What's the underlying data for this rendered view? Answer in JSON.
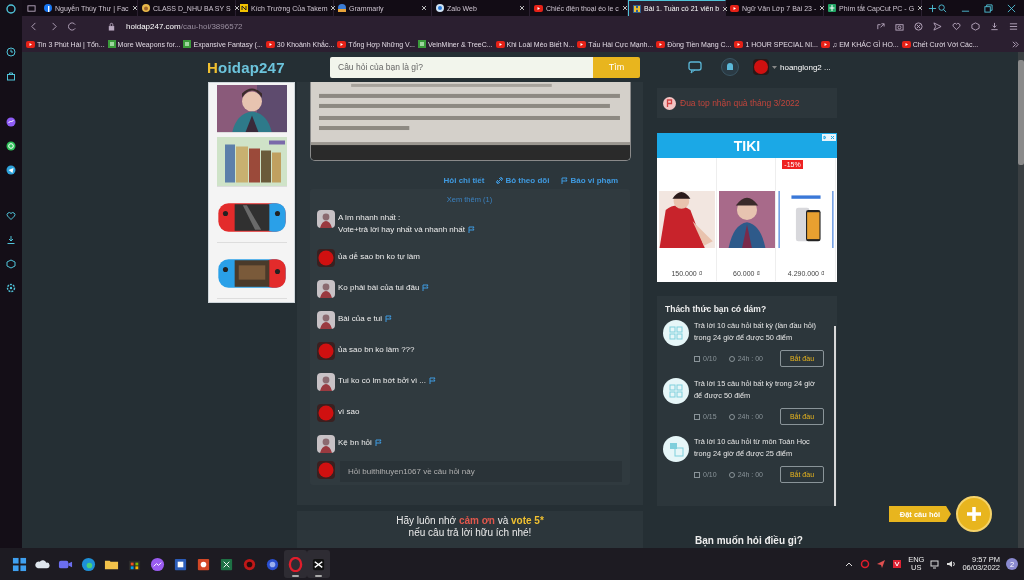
{
  "browser": {
    "tabs": [
      {
        "title": "Nguyễn Thùy Thư | Fac",
        "kind": "facebook",
        "selected": false
      },
      {
        "title": "CLASS D_NHU BA SY S",
        "kind": "class",
        "selected": false
      },
      {
        "title": "Kích Trường Của Takem",
        "kind": "n",
        "selected": false
      },
      {
        "title": "Grammarly",
        "kind": "grammarly",
        "selected": false
      },
      {
        "title": "Zalo Web",
        "kind": "zalo",
        "selected": false
      },
      {
        "title": "Chiếc điện thoại éo le c",
        "kind": "youtube",
        "selected": false
      },
      {
        "title": "Bài 1. Tuần có 21 viên b",
        "kind": "hoidap",
        "selected": true
      },
      {
        "title": "Ngữ Văn Lớp 7 Bài 23 -",
        "kind": "youtube",
        "selected": false
      },
      {
        "title": "Phím tắt CapCut PC - G",
        "kind": "sheets",
        "selected": false
      }
    ],
    "address": {
      "host": "hoidap247.com",
      "path": "/cau-hoi/3896572"
    },
    "bookmarks": [
      {
        "label": "Tin 3 Phút Hài | Tổn...",
        "kind": "youtube"
      },
      {
        "label": "More Weapons for...",
        "kind": "bl"
      },
      {
        "label": "Expansive Fantasy (...",
        "kind": "bl"
      },
      {
        "label": "30 Khoảnh Khắc...",
        "kind": "youtube"
      },
      {
        "label": "Tổng Hợp Những V...",
        "kind": "youtube"
      },
      {
        "label": "VeinMiner & TreeC...",
        "kind": "bl"
      },
      {
        "label": "Khi Loài Mèo Biết N...",
        "kind": "youtube"
      },
      {
        "label": "Tấu Hài Cực Mạnh...",
        "kind": "youtube"
      },
      {
        "label": "Đồng Tiền Mạng C...",
        "kind": "youtube"
      },
      {
        "label": "1 HOUR SPECIAL NI...",
        "kind": "youtube"
      },
      {
        "label": "♫ EM KHÁC GÌ HO...",
        "kind": "youtube"
      },
      {
        "label": "Chết Cười Với Các...",
        "kind": "youtube"
      }
    ]
  },
  "site": {
    "logo": "Hoidap247",
    "search": {
      "placeholder": "Câu hỏi của bạn là gì?",
      "button": "Tìm"
    },
    "user": "hoanglong2 ..."
  },
  "side_pictures": [
    {
      "kind": "picture"
    },
    {
      "kind": "picture"
    },
    {
      "kind": "picture"
    },
    {
      "kind": "picture"
    }
  ],
  "question": {
    "picture": {
      "kind": "picture"
    },
    "actions": [
      "Hỏi chi tiết",
      "Bỏ theo dõi",
      "Báo vi phạm"
    ]
  },
  "comments": {
    "more": "Xem thêm (1)",
    "items": [
      {
        "kind": "asker",
        "lines": [
          "A lm nhanh nhất :",
          "Vote+trả lời hay nhất và nhanh nhất"
        ],
        "flag": true
      },
      {
        "kind": "user",
        "lines": [
          "ủa dễ sao bn ko tự làm"
        ],
        "flag": false
      },
      {
        "kind": "asker",
        "lines": [
          "Ko phải bài của tui đâu"
        ],
        "flag": true
      },
      {
        "kind": "asker",
        "lines": [
          "Bài của e tui"
        ],
        "flag": true
      },
      {
        "kind": "user",
        "lines": [
          "ủa sao bn ko làm ???"
        ],
        "flag": false
      },
      {
        "kind": "asker",
        "lines": [
          "Tui ko có lm bớt bởi vì ..."
        ],
        "flag": true
      },
      {
        "kind": "user",
        "lines": [
          "vì sao"
        ],
        "flag": false
      },
      {
        "kind": "asker",
        "lines": [
          "Kệ bn hỏi"
        ],
        "flag": true
      }
    ],
    "placeholder": "Hỏi buithihuyen1067 về câu hỏi này"
  },
  "reminder": {
    "parts": [
      {
        "text": "Hãy luôn nhớ ",
        "kind": "plain"
      },
      {
        "text": "cảm ơn",
        "kind": "thanks"
      },
      {
        "text": " và ",
        "kind": "plain"
      },
      {
        "text": "vote 5*",
        "kind": "vote"
      }
    ],
    "line2": "nếu câu trả lời hữu ích nhé!"
  },
  "promo": "Đua top nhận quà tháng 3/2022",
  "ad": {
    "brand": "TIKI",
    "badge": "-15%",
    "products": [
      {
        "price": "150.000 ₫"
      },
      {
        "price": "60.000 ₫"
      },
      {
        "price": "4.290.000 ₫"
      }
    ]
  },
  "challenges": {
    "title": "Thách thức bạn có dám?",
    "items": [
      {
        "text": "Trả lời 10 câu hỏi  bất kỳ (lần đầu hỏi) trong 24 giờ để được 50 điểm",
        "progress": "0/10",
        "time": "24h : 00",
        "button": "Bắt đầu",
        "kind": "grid"
      },
      {
        "text": "Trả lời 15 câu hỏi  bất kỳ  trong 24 giờ để được 50 điểm",
        "progress": "0/15",
        "time": "24h : 00",
        "button": "Bắt đầu",
        "kind": "grid"
      },
      {
        "text": "Trả lời 10 câu hỏi  từ môn Toán Học trong 24 giờ để được 25 điểm",
        "progress": "0/10",
        "time": "24h : 00",
        "button": "Bắt đầu",
        "kind": "math"
      }
    ]
  },
  "ask_title": "Bạn muốn hỏi điều gì?",
  "fab": {
    "label": "Đặt câu hỏi"
  },
  "taskbar": {
    "apps": [
      {
        "kind": "start",
        "running": false
      },
      {
        "kind": "cloud",
        "running": false
      },
      {
        "kind": "camera",
        "running": false
      },
      {
        "kind": "edge",
        "running": false
      },
      {
        "kind": "folder",
        "running": false
      },
      {
        "kind": "store",
        "running": false
      },
      {
        "kind": "messenger",
        "running": false
      },
      {
        "kind": "word",
        "running": false
      },
      {
        "kind": "powerpoint",
        "running": false
      },
      {
        "kind": "excel",
        "running": false
      },
      {
        "kind": "redapp",
        "running": false
      },
      {
        "kind": "blueapp",
        "running": false
      },
      {
        "kind": "opera",
        "running": true
      },
      {
        "kind": "capcut",
        "running": true
      }
    ],
    "lang": "ENG",
    "region": "US",
    "time": "9:57 PM",
    "date": "06/03/2022",
    "badge": "2"
  }
}
